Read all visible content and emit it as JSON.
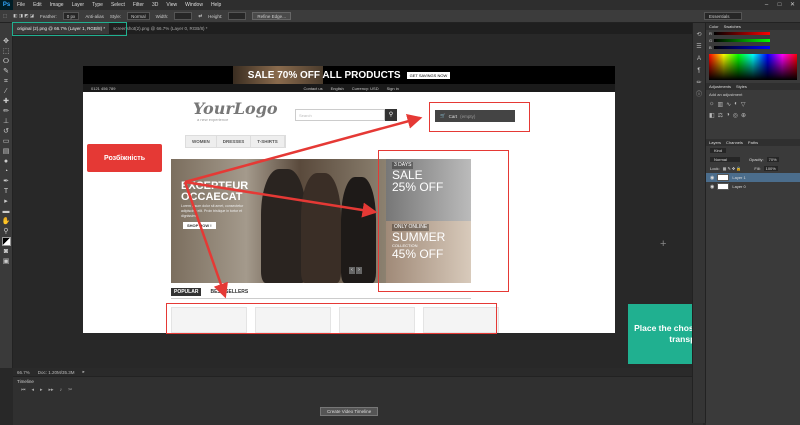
{
  "app": {
    "logo": "Ps"
  },
  "menu": [
    "File",
    "Edit",
    "Image",
    "Layer",
    "Type",
    "Select",
    "Filter",
    "3D",
    "View",
    "Window",
    "Help"
  ],
  "options": {
    "feather_label": "Feather:",
    "feather_value": "0 px",
    "antialias": "Anti-alias",
    "style_label": "Style:",
    "style_value": "Normal",
    "width_label": "Width:",
    "height_label": "Height:",
    "refine_edge": "Refine Edge...",
    "workspace": "Essentials"
  },
  "tabs": [
    {
      "label": "original (2).png @ 66.7% (Layer 1, RGB/8) *"
    },
    {
      "label": "screenshot(2).png @ 66.7% (Layer 0, RGB/8) *"
    }
  ],
  "doc": {
    "banner": "SALE 70% OFF ALL PRODUCTS",
    "banner_button": "GET SAVINGS NOW",
    "phone": "0121 456 789",
    "topbar_links": [
      "Contact us",
      "English",
      "Currency: USD",
      "Sign in"
    ],
    "logo": "YourLogo",
    "tagline": "a new experience",
    "search_placeholder": "Search",
    "cart": "Cart",
    "cart_status": "(empty)",
    "nav": [
      "WOMEN",
      "DRESSES",
      "T-SHIRTS"
    ],
    "hero_title_1": "EXCEPTEUR",
    "hero_title_2": "OCCAECAT",
    "hero_text": "Lorem ipsum dolor sit amet, consectetur adipiscing elit. Proin tristique in tortor et dignissim.",
    "hero_button": "SHOP NOW !",
    "promo1_line1": "3 DAYS",
    "promo1_line2": "SALE",
    "promo1_line3": "25% OFF",
    "promo2_line1": "ONLY ONLINE",
    "promo2_line2": "SUMMER",
    "promo2_line3": "COLLECTION",
    "promo2_line4": "45% OFF",
    "tab_popular": "POPULAR",
    "tab_best": "BEST SELLERS"
  },
  "annotations": {
    "callout": "Розбіжність",
    "tip": "Place the chosen layer and set transparency"
  },
  "status": {
    "zoom": "66.7%",
    "doc": "Doc: 1.20M/35.3M"
  },
  "timeline": {
    "title": "Timeline",
    "create": "Create Video Timeline"
  },
  "panels": {
    "color_tabs": [
      "Color",
      "Swatches"
    ],
    "color_labels": [
      "R",
      "G",
      "B"
    ],
    "adjust_tabs": [
      "Adjustments",
      "Styles"
    ],
    "adjust_title": "Add an adjustment",
    "layers_tabs": [
      "Layers",
      "Channels",
      "Paths"
    ],
    "kind": "Kind",
    "blend": "Normal",
    "opacity_label": "Opacity:",
    "opacity_value": "70%",
    "lock_label": "Lock:",
    "fill_label": "Fill:",
    "fill_value": "100%",
    "layers": [
      "Layer 1",
      "Layer 0"
    ]
  },
  "colors": {
    "accent_red": "#e53935",
    "accent_green": "#20b090"
  }
}
